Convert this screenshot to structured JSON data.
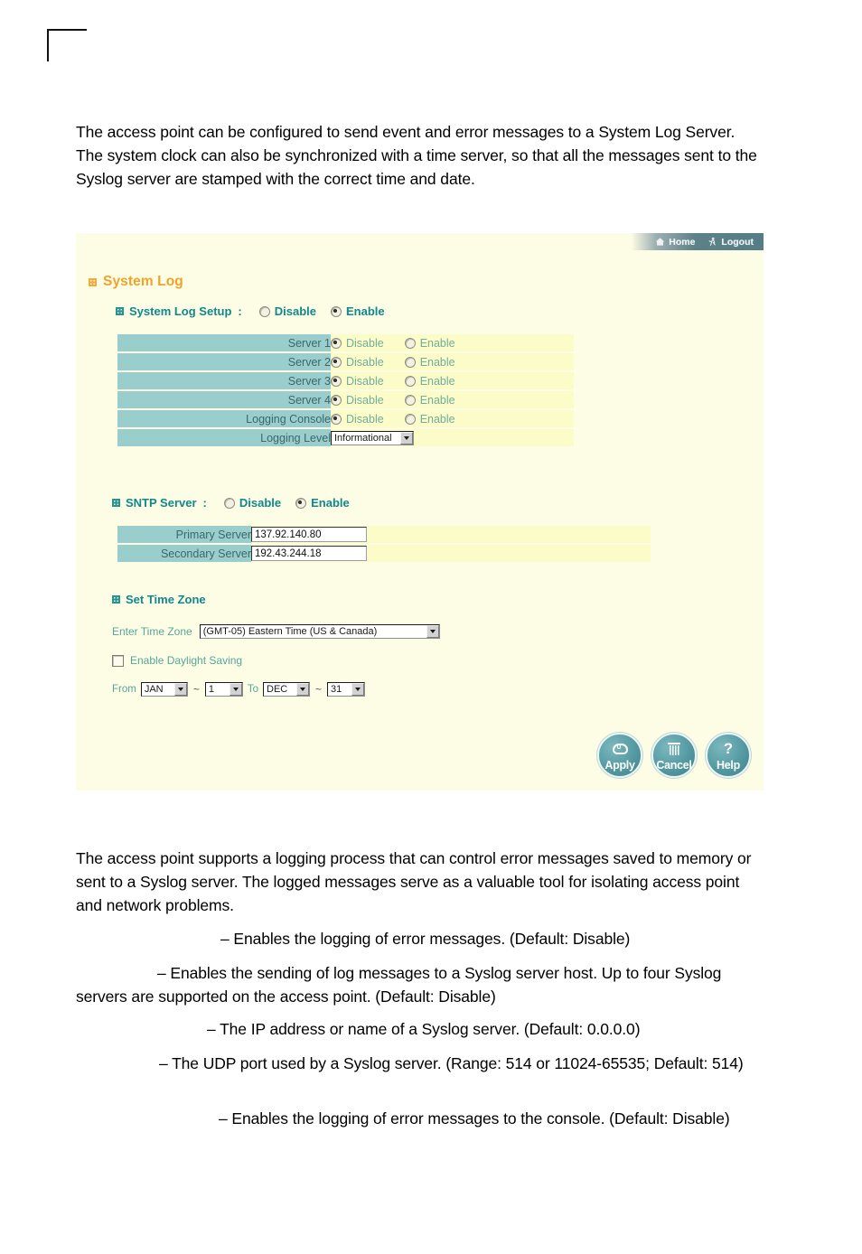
{
  "document": {
    "intro_paragraph": "The access point can be configured to send event and error messages to a System Log Server. The system clock can also be synchronized with a time server, so that all the messages sent to the Syslog server are stamped with the correct time and date.",
    "support_paragraph": "The access point supports a logging process that can control error messages saved to memory or sent to a Syslog server. The logged messages serve as a valuable tool for isolating access point and network problems.",
    "definitions": [
      "– Enables the logging of error messages. (Default: Disable)",
      "– Enables the sending of log messages to a Syslog server host. Up to four Syslog servers are supported on the access point. (Default: Disable)",
      "– The IP address or name of a Syslog server. (Default: 0.0.0.0)",
      "– The UDP port used by a Syslog server. (Range: 514 or 11024-65535; Default: 514)",
      "– Enables the logging of error messages to the console. (Default: Disable)"
    ]
  },
  "ui": {
    "topnav": {
      "home_label": "Home",
      "logout_label": "Logout"
    },
    "page_title": "System Log",
    "syslog_setup": {
      "heading": "System Log Setup",
      "colon": ":",
      "disable_label": "Disable",
      "enable_label": "Enable",
      "selected": "Enable",
      "rows": [
        {
          "label": "Server 1",
          "disable_label": "Disable",
          "enable_label": "Enable",
          "selected": "Disable"
        },
        {
          "label": "Server 2",
          "disable_label": "Disable",
          "enable_label": "Enable",
          "selected": "Disable"
        },
        {
          "label": "Server 3",
          "disable_label": "Disable",
          "enable_label": "Enable",
          "selected": "Disable"
        },
        {
          "label": "Server 4",
          "disable_label": "Disable",
          "enable_label": "Enable",
          "selected": "Disable"
        },
        {
          "label": "Logging Console",
          "disable_label": "Disable",
          "enable_label": "Enable",
          "selected": "Disable"
        }
      ],
      "logging_level": {
        "label": "Logging Level",
        "value": "Informational"
      }
    },
    "sntp": {
      "heading": "SNTP Server",
      "colon": ":",
      "disable_label": "Disable",
      "enable_label": "Enable",
      "selected": "Enable",
      "primary": {
        "label": "Primary Server",
        "value": "137.92.140.80"
      },
      "secondary": {
        "label": "Secondary Server",
        "value": "192.43.244.18"
      }
    },
    "timezone": {
      "heading": "Set Time Zone",
      "enter_label": "Enter Time Zone",
      "value": "(GMT-05) Eastern Time (US & Canada)",
      "daylight_label": "Enable Daylight Saving",
      "daylight_checked": false,
      "from_word": "From",
      "to_word": "To",
      "tilde": "~",
      "from_month": "JAN",
      "from_day": "1",
      "to_month": "DEC",
      "to_day": "31"
    },
    "actions": {
      "apply_label": "Apply",
      "cancel_label": "Cancel",
      "help_label": "Help"
    },
    "colors": {
      "panel_bg": "#fdfce5",
      "label_cell": "#9acecd",
      "value_cell": "#fcfcc9",
      "title_orange": "#f0a32a",
      "heading_teal": "#11888b",
      "button_teal": "#559aa2"
    }
  }
}
